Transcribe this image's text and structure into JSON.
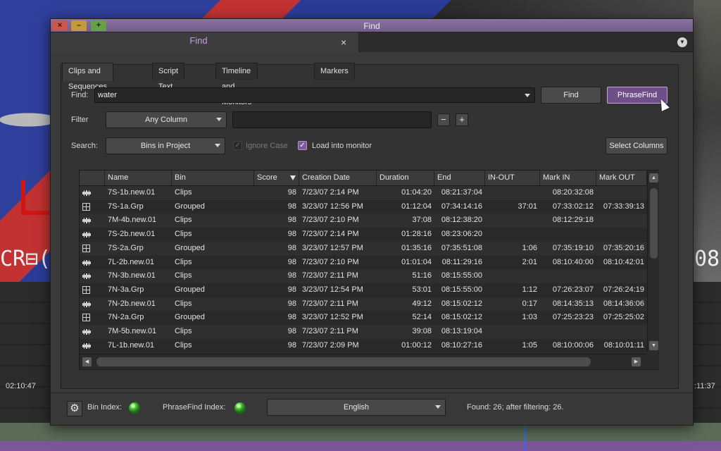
{
  "background": {
    "timecode_left": "CR⊟(",
    "timecode_right": "08",
    "timeline_time_left": "02:10:47",
    "timeline_time_right": ":11:37"
  },
  "window": {
    "title": "Find",
    "close_glyph": "×",
    "min_glyph": "–",
    "max_glyph": "+"
  },
  "panel_tab": {
    "label": "Find",
    "close_glyph": "×"
  },
  "subtabs": [
    "Clips and Sequences",
    "Script Text",
    "Timeline and Monitors",
    "Markers"
  ],
  "find": {
    "label": "Find:",
    "value": "water",
    "find_button": "Find",
    "phrasefind_button": "PhraseFind"
  },
  "filter": {
    "label": "Filter",
    "column": "Any Column",
    "value": "",
    "minus": "−",
    "plus": "+"
  },
  "search": {
    "label": "Search:",
    "scope": "Bins in Project",
    "ignore_case": "Ignore Case",
    "ignore_case_checked": true,
    "ignore_case_disabled": true,
    "load_monitor": "Load into monitor",
    "load_monitor_checked": true,
    "select_columns": "Select Columns"
  },
  "table": {
    "columns": [
      "",
      "Name",
      "Bin",
      "Score",
      "Creation Date",
      "Duration",
      "End",
      "IN-OUT",
      "Mark IN",
      "Mark OUT"
    ],
    "rows": [
      {
        "icon": "clip-icon",
        "name": "7S-1b.new.01",
        "bin": "Clips",
        "score": "98",
        "created": "7/23/07 2:14 PM",
        "duration": "01:04:20",
        "end": "08:21:37:04",
        "inout": "",
        "markin": "08:20:32:08",
        "markout": ""
      },
      {
        "icon": "group-icon",
        "name": "7S-1a.Grp",
        "bin": "Grouped",
        "score": "98",
        "created": "3/23/07 12:56 PM",
        "duration": "01:12:04",
        "end": "07:34:14:16",
        "inout": "37:01",
        "markin": "07:33:02:12",
        "markout": "07:33:39:13"
      },
      {
        "icon": "clip-icon",
        "name": "7M-4b.new.01",
        "bin": "Clips",
        "score": "98",
        "created": "7/23/07 2:10 PM",
        "duration": "37:08",
        "end": "08:12:38:20",
        "inout": "",
        "markin": "08:12:29:18",
        "markout": ""
      },
      {
        "icon": "clip-icon",
        "name": "7S-2b.new.01",
        "bin": "Clips",
        "score": "98",
        "created": "7/23/07 2:14 PM",
        "duration": "01:28:16",
        "end": "08:23:06:20",
        "inout": "",
        "markin": "",
        "markout": ""
      },
      {
        "icon": "group-icon",
        "name": "7S-2a.Grp",
        "bin": "Grouped",
        "score": "98",
        "created": "3/23/07 12:57 PM",
        "duration": "01:35:16",
        "end": "07:35:51:08",
        "inout": "1:06",
        "markin": "07:35:19:10",
        "markout": "07:35:20:16"
      },
      {
        "icon": "clip-icon",
        "name": "7L-2b.new.01",
        "bin": "Clips",
        "score": "98",
        "created": "7/23/07 2:10 PM",
        "duration": "01:01:04",
        "end": "08:11:29:16",
        "inout": "2:01",
        "markin": "08:10:40:00",
        "markout": "08:10:42:01"
      },
      {
        "icon": "clip-icon",
        "name": "7N-3b.new.01",
        "bin": "Clips",
        "score": "98",
        "created": "7/23/07 2:11 PM",
        "duration": "51:16",
        "end": "08:15:55:00",
        "inout": "",
        "markin": "",
        "markout": ""
      },
      {
        "icon": "group-icon",
        "name": "7N-3a.Grp",
        "bin": "Grouped",
        "score": "98",
        "created": "3/23/07 12:54 PM",
        "duration": "53:01",
        "end": "08:15:55:00",
        "inout": "1:12",
        "markin": "07:26:23:07",
        "markout": "07:26:24:19"
      },
      {
        "icon": "clip-icon",
        "name": "7N-2b.new.01",
        "bin": "Clips",
        "score": "98",
        "created": "7/23/07 2:11 PM",
        "duration": "49:12",
        "end": "08:15:02:12",
        "inout": "0:17",
        "markin": "08:14:35:13",
        "markout": "08:14:36:06"
      },
      {
        "icon": "group-icon",
        "name": "7N-2a.Grp",
        "bin": "Grouped",
        "score": "98",
        "created": "3/23/07 12:52 PM",
        "duration": "52:14",
        "end": "08:15:02:12",
        "inout": "1:03",
        "markin": "07:25:23:23",
        "markout": "07:25:25:02"
      },
      {
        "icon": "clip-icon",
        "name": "7M-5b.new.01",
        "bin": "Clips",
        "score": "98",
        "created": "7/23/07 2:11 PM",
        "duration": "39:08",
        "end": "08:13:19:04",
        "inout": "",
        "markin": "",
        "markout": ""
      },
      {
        "icon": "clip-icon",
        "name": "7L-1b.new.01",
        "bin": "Clips",
        "score": "98",
        "created": "7/23/07 2:09 PM",
        "duration": "01:00:12",
        "end": "08:10:27:16",
        "inout": "1:05",
        "markin": "08:10:00:06",
        "markout": "08:10:01:11"
      }
    ]
  },
  "status": {
    "bin_index": "Bin Index:",
    "phrasefind_index": "PhraseFind Index:",
    "language": "English",
    "found": "Found: 26; after filtering: 26.",
    "indicator_color": "#4ec43a"
  },
  "colors": {
    "accent": "#7b5c95",
    "tab_label": "#c79ae6",
    "titlebar": "#7e6794"
  }
}
